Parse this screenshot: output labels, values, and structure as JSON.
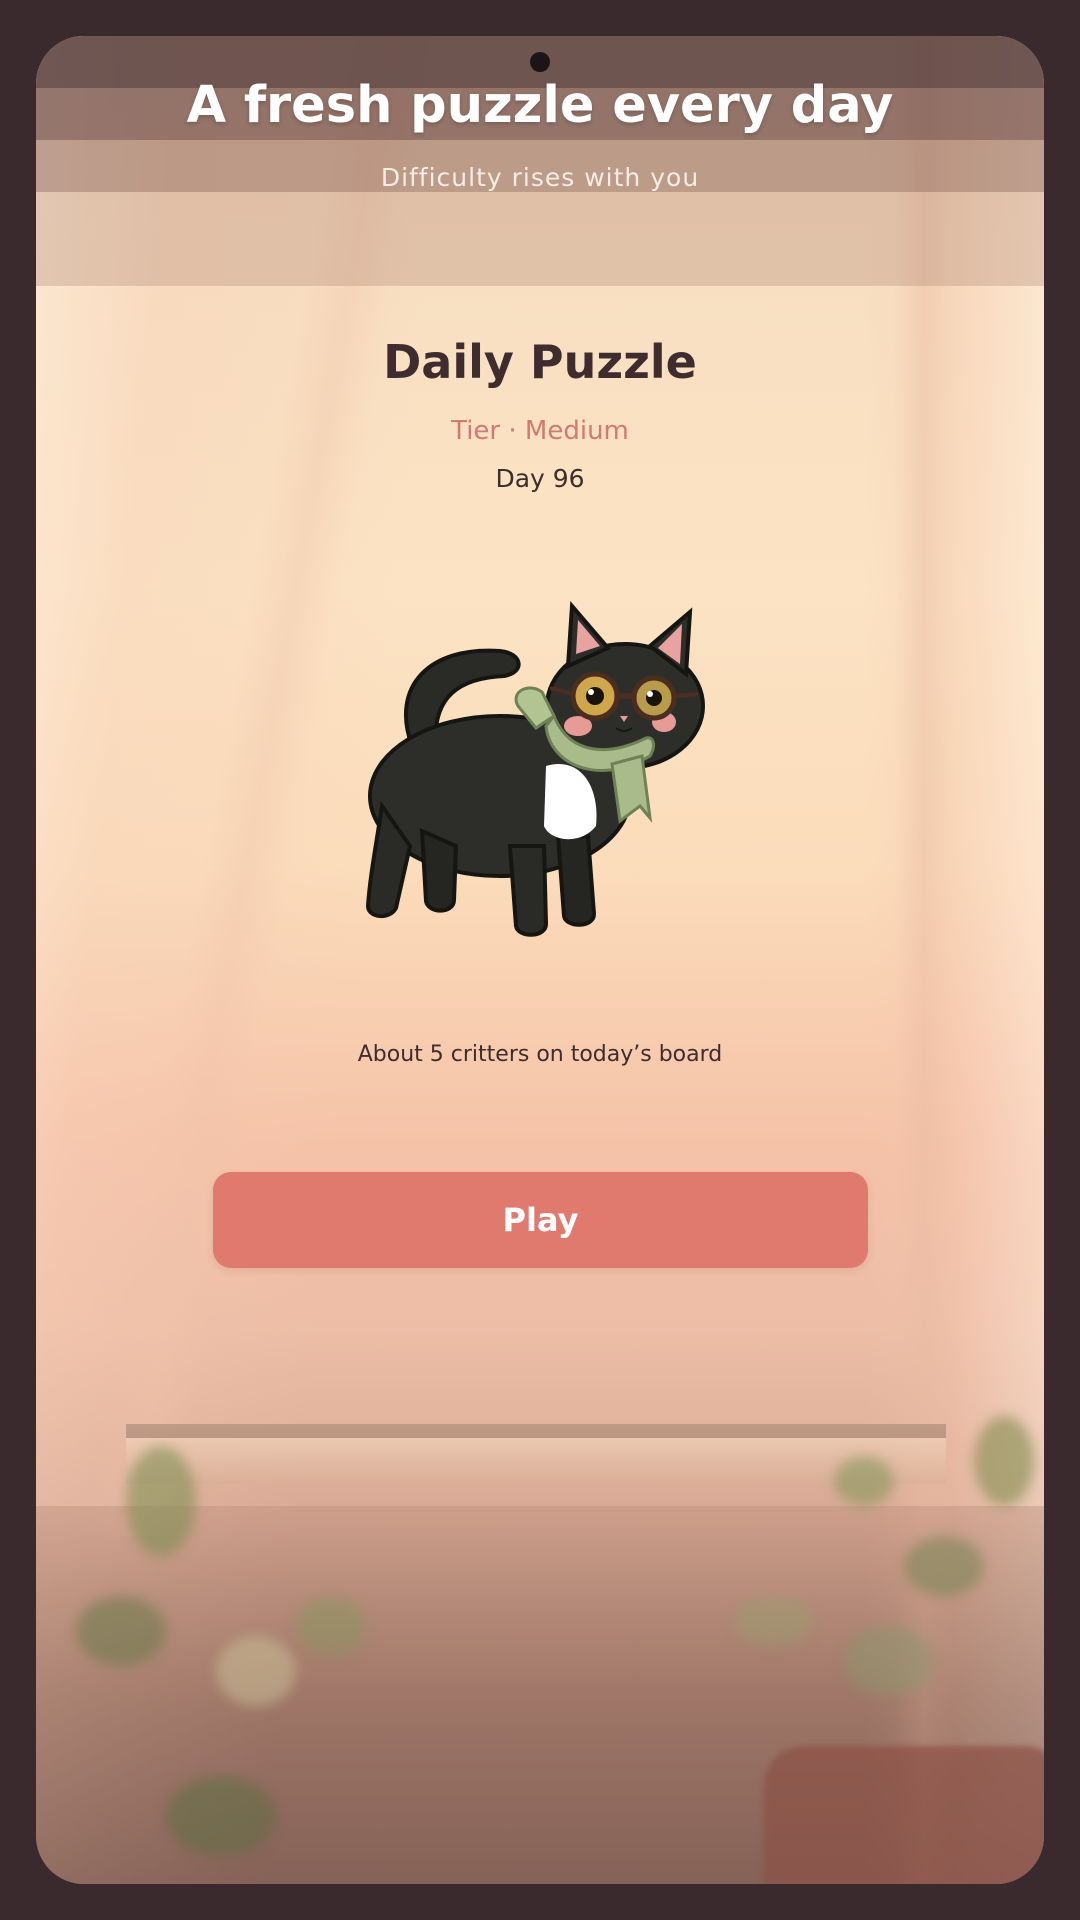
{
  "header": {
    "headline": "A fresh puzzle every day",
    "subheadline": "Difficulty rises with you"
  },
  "puzzle": {
    "title": "Daily Puzzle",
    "tier": "Tier · Medium",
    "day": "Day 96",
    "critters_text": "About 5 critters on today’s board"
  },
  "actions": {
    "play_label": "Play"
  },
  "mascot": {
    "icon": "black-cat-with-glasses-and-scarf"
  },
  "colors": {
    "accent": "#e07a6e",
    "tier_text": "#d07b6e",
    "text_dark": "#3e2c2e",
    "frame": "#3b2a2d"
  }
}
